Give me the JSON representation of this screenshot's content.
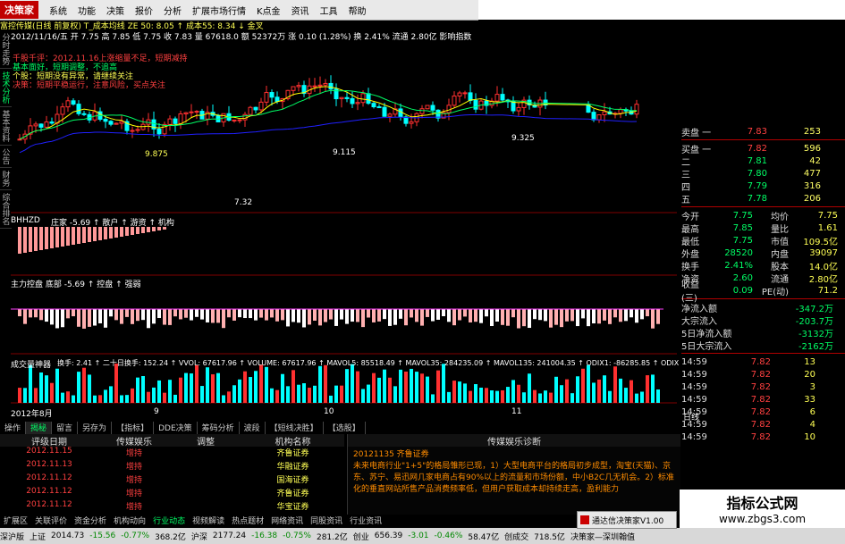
{
  "app": {
    "logo": "决策家",
    "menu": [
      "系统",
      "功能",
      "决策",
      "报价",
      "分析",
      "扩展市场行情",
      "K点金",
      "资讯",
      "工具",
      "帮助"
    ]
  },
  "infobar": {
    "line1": "富控传媒(日线 前复权) T_成本均线 ZE 50: 8.05 ↑ 成本55: 8.34 ↓ 金叉",
    "line2": "2012/11/16/五 开 7.75 高 7.85 低 7.75 收 7.83 量 67618.0 额 52372万 涨 0.10 (1.28%) 换 2.41% 流通 2.80亿 影响指数"
  },
  "lefttabs": [
    "分时走势",
    "技术分析",
    "基本资料",
    "公告",
    "财务",
    "综合排名"
  ],
  "chart": {
    "annotations": [
      "千股千评：2012.11.16上涨缩量不足，短期减持",
      "基本面好，短期调整，不追高",
      "个股：短期没有异常，请继续关注",
      "决策：短期平稳运行，注意风险，买点关注"
    ],
    "price_labels": [
      "9.325",
      "9.115",
      "7.32",
      "9.875"
    ],
    "ind1_label": "BHHZD",
    "ind1_text": "庄家 -5.69 ↑ 散户 ↑ 游资 ↑ 机构",
    "ind2_text": "主力控盘  底部 -5.69 ↑ 控盘 ↑ 强弱",
    "ind2_side": "主力进出",
    "ind3_label": "成交量神器",
    "ind3_text": "换手: 2.41 ↑ 二十日换手: 152.24 ↑ VVOL: 67617.96 ↑ VOLUME: 67617.96 ↑ MAVOL5: 85518.49 ↑ MAVOL35: 284235.09 ↑ MAVOL135: 241004.35 ↑ ODIX1: -86285.85 ↑ ODIX",
    "x_labels": [
      "2012年8月",
      "9",
      "10",
      "11"
    ],
    "right_scale": [
      "15000",
      "10000",
      "5000",
      "0"
    ]
  },
  "rpanel": {
    "sell1": {
      "label": "卖盘 一",
      "price": "7.83",
      "vol": "253"
    },
    "buy": [
      {
        "label": "买盘 一",
        "price": "7.82",
        "vol": "596"
      },
      {
        "label": "二",
        "price": "7.81",
        "vol": "42"
      },
      {
        "label": "三",
        "price": "7.80",
        "vol": "477"
      },
      {
        "label": "四",
        "price": "7.79",
        "vol": "316"
      },
      {
        "label": "五",
        "price": "7.78",
        "vol": "206"
      }
    ],
    "stats": [
      {
        "k": "今开",
        "v": "7.75",
        "k2": "均价",
        "v2": "7.75"
      },
      {
        "k": "最高",
        "v": "7.85",
        "k2": "量比",
        "v2": "1.61"
      },
      {
        "k": "最低",
        "v": "7.75",
        "k2": "市值",
        "v2": "109.5亿"
      },
      {
        "k": "外盘",
        "v": "28520",
        "k2": "内盘",
        "v2": "39097"
      },
      {
        "k": "换手",
        "v": "2.41%",
        "k2": "股本",
        "v2": "14.0亿"
      },
      {
        "k": "净资",
        "v": "2.60",
        "k2": "流通",
        "v2": "2.80亿"
      },
      {
        "k": "收益(三)",
        "v": "0.09",
        "k2": "PE(动)",
        "v2": "71.2"
      }
    ],
    "flows": [
      {
        "k": "净流入额",
        "v": "-347.2万"
      },
      {
        "k": "大宗流入",
        "v": "-203.7万"
      },
      {
        "k": "5日净流入额",
        "v": "-3132万"
      },
      {
        "k": "5日大宗流入",
        "v": "-2162万"
      }
    ],
    "ticks": [
      {
        "t": "14:59",
        "p": "7.82",
        "v": "13"
      },
      {
        "t": "14:59",
        "p": "7.82",
        "v": "20"
      },
      {
        "t": "14:59",
        "p": "7.82",
        "v": "3"
      },
      {
        "t": "14:59",
        "p": "7.82",
        "v": "33"
      },
      {
        "t": "14:59",
        "p": "7.82",
        "v": "6"
      },
      {
        "t": "14:59",
        "p": "7.82",
        "v": "4"
      },
      {
        "t": "14:59",
        "p": "7.82",
        "v": "10"
      }
    ],
    "side_tab": "日线"
  },
  "btabs": [
    "操作",
    "揭秘",
    "留言",
    "另存为",
    "【指标】",
    "DDE决策",
    "筹码分析",
    "波段",
    "【短线决胜】",
    "【选股】"
  ],
  "table": {
    "headers": [
      "评级日期",
      "传媒娱乐",
      "调整",
      "机构名称"
    ],
    "rows": [
      [
        "2012.11.15",
        "增持",
        "",
        "齐鲁证券"
      ],
      [
        "2012.11.13",
        "增持",
        "",
        "华融证券"
      ],
      [
        "2012.11.12",
        "增持",
        "",
        "国海证券"
      ],
      [
        "2012.11.12",
        "增持",
        "",
        "齐鲁证券"
      ],
      [
        "2012.11.12",
        "增持",
        "",
        "华宝证券"
      ]
    ]
  },
  "diag": {
    "head": "传媒娱乐诊断",
    "date_line": "20121135  齐鲁证券",
    "text": "未来电商行业\"1+5\"的格局雏形已现，1）大型电商平台的格局初步成型，淘宝(天猫)、京东、苏宁、易迅网几家电商占有90%以上的流量和市场份额，中小B2C几无机会。2）标准化的垂直网站所售产品消费频率低，但用户获取成本却持续走高，盈利能力"
  },
  "bottabs2": [
    "扩展区",
    "关联评价",
    "资金分析",
    "机构动向",
    "行业动态",
    "视频解读",
    "热点题材",
    "网络资讯",
    "同股资讯",
    "行业资讯"
  ],
  "statusbar": [
    "深沪版",
    "上证",
    "2014.73",
    "-15.56",
    "-0.77%",
    "368.2亿",
    "沪深",
    "2177.24",
    "-16.38",
    "-0.75%",
    "281.2亿",
    "创业",
    "656.39",
    "-3.01",
    "-0.46%",
    "58.47亿",
    "创成交",
    "718.5亿",
    "决策家—深圳翰值"
  ],
  "watermark": {
    "t1": "指标公式网",
    "t2": "www.zbgs3.com"
  },
  "popup": "通达信决策家V1.00",
  "colors": {
    "up": "#ff3030",
    "down": "#00ffff",
    "volume": "#ffffff",
    "ma_yellow": "#ffff00",
    "ma_green": "#00ff66",
    "ma_blue": "#2020ff"
  }
}
